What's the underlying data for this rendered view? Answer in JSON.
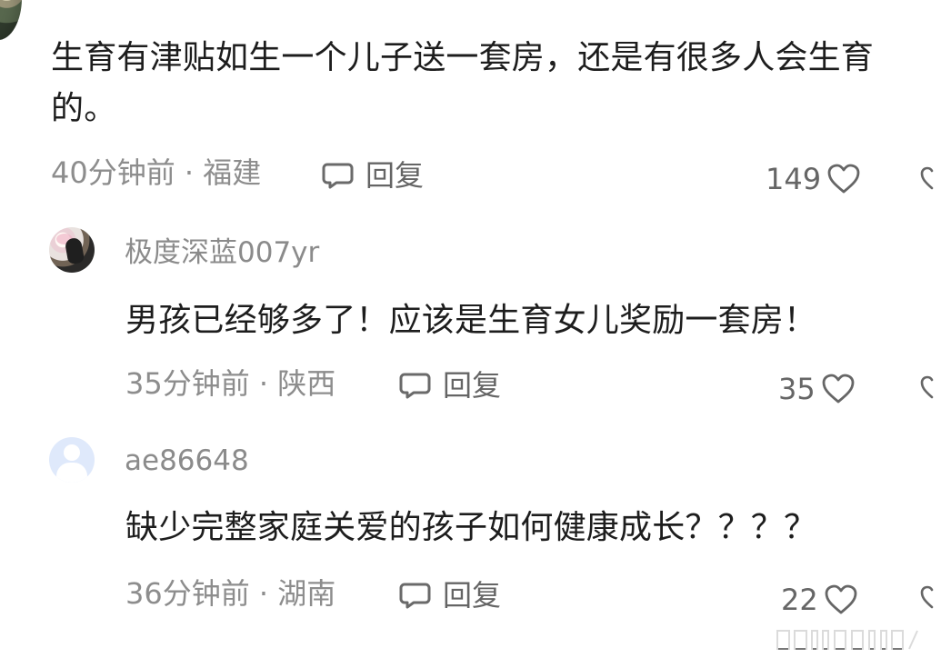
{
  "comments": [
    {
      "text": "生育有津贴如生一个儿子送一套房，还是有很多人会生育的。",
      "meta": "40分钟前 · 福建",
      "reply_label": "回复",
      "likes": "149"
    },
    {
      "username": "极度深蓝007yr",
      "text": "男孩已经够多了！应该是生育女儿奖励一套房！",
      "meta": "35分钟前 · 陕西",
      "reply_label": "回复",
      "likes": "35"
    },
    {
      "username": "ae86648",
      "text": "缺少完整家庭关爱的孩子如何健康成长？？？？",
      "meta": "36分钟前 · 湖南",
      "reply_label": "回复",
      "likes": "22"
    }
  ],
  "icons": {
    "reply": "comment-icon",
    "like": "heart-icon",
    "watermark": "watermark-icon"
  }
}
